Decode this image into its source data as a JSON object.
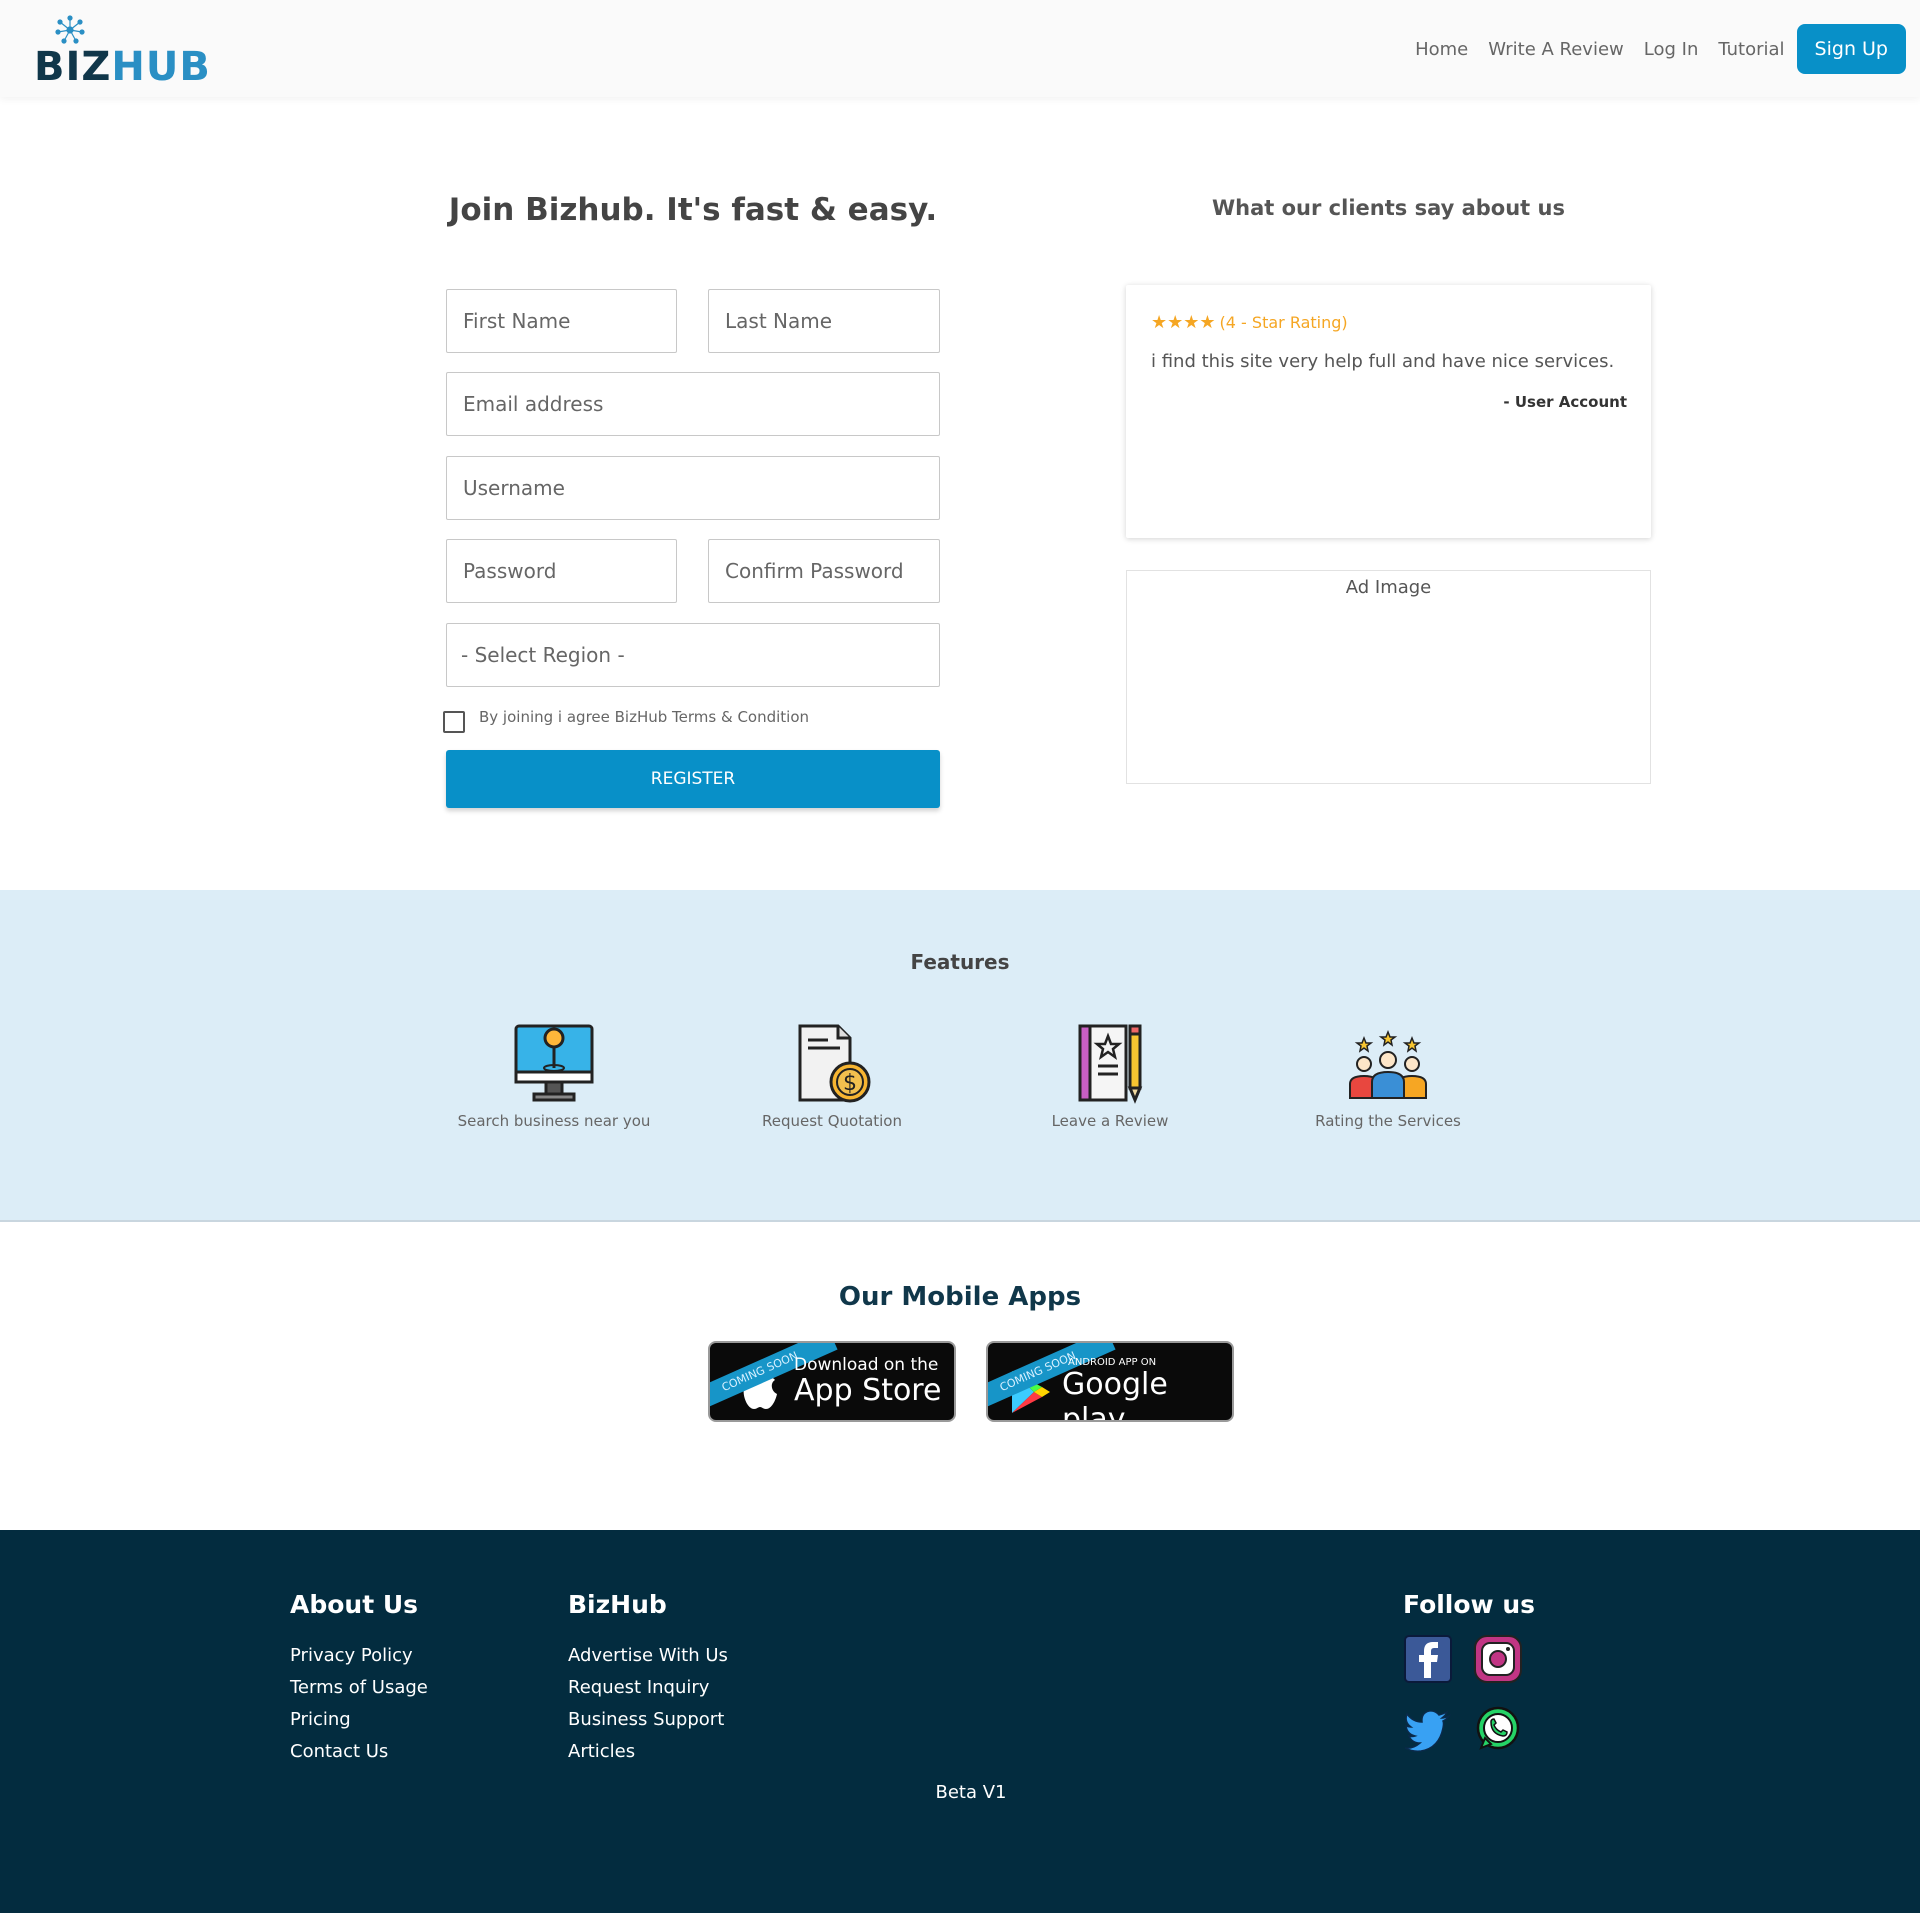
{
  "header": {
    "logo_part1": "BIZ",
    "logo_part2": "HUB",
    "nav": {
      "home": "Home",
      "write_review": "Write A Review",
      "login": "Log In",
      "tutorial": "Tutorial",
      "signup": "Sign Up"
    }
  },
  "register": {
    "title": "Join Bizhub. It's fast & easy.",
    "first_name_placeholder": "First Name",
    "last_name_placeholder": "Last Name",
    "email_placeholder": "Email address",
    "username_placeholder": "Username",
    "password_placeholder": "Password",
    "confirm_password_placeholder": "Confirm Password",
    "region_placeholder": "- Select Region -",
    "agree_text": "By joining i agree BizHub Terms & Condition",
    "button": "REGISTER"
  },
  "testimonials": {
    "title": "What our clients say about us",
    "stars": "★★★★",
    "rating_text": "(4 - Star Rating)",
    "rating": 4,
    "quote": "i find this site very help full and have nice services.",
    "author": "- User Account"
  },
  "ad": {
    "label": "Ad Image"
  },
  "features": {
    "title": "Features",
    "items": [
      {
        "label": "Search business near you",
        "icon": "monitor-location-icon"
      },
      {
        "label": "Request Quotation",
        "icon": "document-dollar-icon"
      },
      {
        "label": "Leave a Review",
        "icon": "notebook-pencil-icon"
      },
      {
        "label": "Rating the Services",
        "icon": "users-stars-icon"
      }
    ]
  },
  "apps": {
    "title": "Our Mobile Apps",
    "ribbon": "COMING SOON",
    "appstore_small": "Download on the",
    "appstore_big": "App Store",
    "google_small": "ANDROID APP ON",
    "google_big": "Google play"
  },
  "footer": {
    "about_title": "About Us",
    "about_links": [
      "Privacy Policy",
      "Terms of Usage",
      "Pricing",
      "Contact Us"
    ],
    "bizhub_title": "BizHub",
    "bizhub_links": [
      "Advertise With Us",
      "Request Inquiry",
      "Business Support",
      "Articles"
    ],
    "follow_title": "Follow us",
    "version": "Beta V1"
  },
  "colors": {
    "primary": "#0890c8",
    "footer_bg": "#032c3f",
    "features_bg": "#dcedf7",
    "star": "#f5a623"
  }
}
